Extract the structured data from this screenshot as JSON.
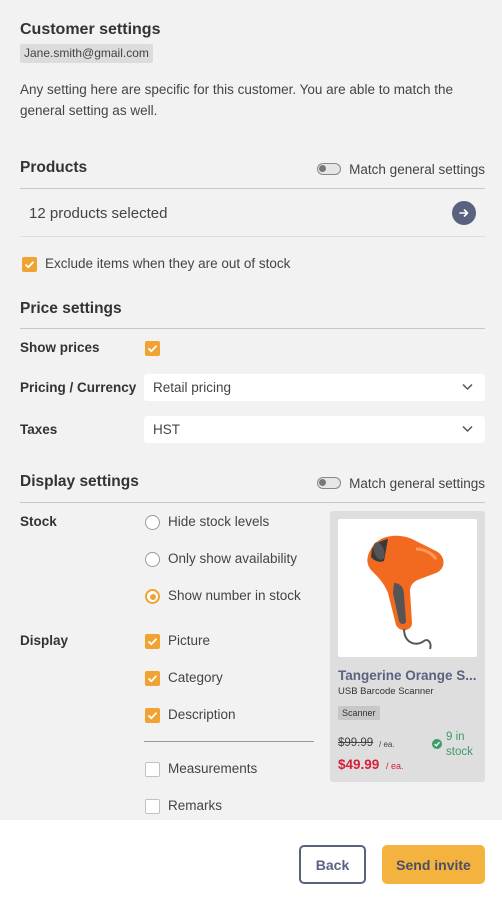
{
  "header": {
    "title": "Customer settings",
    "email": "Jane.smith@gmail.com",
    "intro": "Any setting here are specific for this customer. You are able to match the general setting as well."
  },
  "products": {
    "heading": "Products",
    "match_label": "Match general settings",
    "selected_text": "12 products selected",
    "exclude_label": "Exclude items when they are out of stock"
  },
  "price_settings": {
    "heading": "Price settings",
    "show_prices_label": "Show prices",
    "pricing_label": "Pricing / Currency",
    "pricing_value": "Retail pricing",
    "taxes_label": "Taxes",
    "taxes_value": "HST"
  },
  "display_settings": {
    "heading": "Display settings",
    "match_label": "Match general settings",
    "stock_label": "Stock",
    "stock_options": [
      "Hide stock levels",
      "Only show availability",
      "Show number in stock"
    ],
    "display_label": "Display",
    "display_options": [
      "Picture",
      "Category",
      "Description",
      "Measurements",
      "Remarks"
    ]
  },
  "product_card": {
    "name": "Tangerine Orange S...",
    "subtitle": "USB Barcode Scanner",
    "tag": "Scanner",
    "old_price": "$99.99",
    "new_price": "$49.99",
    "per_unit": "/ ea.",
    "stock": "9 in stock"
  },
  "footer": {
    "back_label": "Back",
    "send_label": "Send invite"
  },
  "colors": {
    "accent": "#f0a330",
    "navy": "#5a6280",
    "sale_red": "#d6203a",
    "stock_green": "#3f9a69"
  },
  "icons": {
    "arrow": "arrow-right-icon",
    "chevron": "chevron-down-icon",
    "check": "check-icon",
    "stock": "check-circle-icon"
  }
}
